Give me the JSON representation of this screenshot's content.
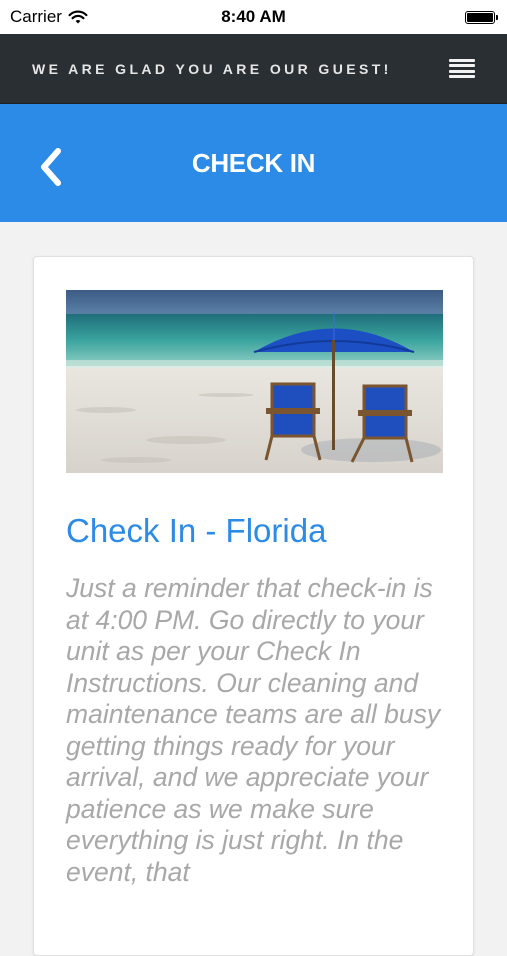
{
  "status_bar": {
    "carrier": "Carrier",
    "time": "8:40 AM",
    "wifi_icon": "wifi-icon",
    "battery_icon": "battery-icon",
    "battery_level": 1.0
  },
  "header": {
    "tagline": "WE ARE GLAD YOU ARE OUR GUEST!",
    "menu_icon": "hamburger-menu-icon"
  },
  "title_bar": {
    "title": "CHECK IN",
    "back_icon": "chevron-left-icon",
    "background_color": "#2b8be6"
  },
  "card": {
    "image_icon": "beach-umbrella-chairs-image",
    "title": "Check In - Florida",
    "body": "Just a reminder that check-in is at 4:00 PM. Go directly to your unit as per your Check In Instructions. Our cleaning and maintenance teams are all busy getting things ready for your arrival, and we appreciate your patience as we make sure everything is just right. In the event, that"
  },
  "colors": {
    "header_bg": "#2a2f33",
    "accent": "#2b8be6",
    "body_text": "#a8a8a8"
  }
}
